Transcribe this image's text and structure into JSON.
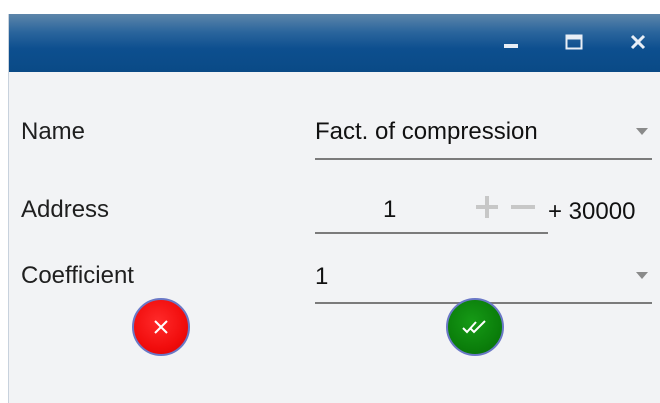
{
  "titlebar": {
    "minimize_icon": "minimize-icon",
    "maximize_icon": "maximize-icon",
    "close_icon": "close-icon",
    "color": "#0d4f8f"
  },
  "form": {
    "name": {
      "label": "Name",
      "value": "Fact. of compression"
    },
    "address": {
      "label": "Address",
      "value": "1",
      "suffix": "+ 30000",
      "increment_icon": "plus-icon",
      "decrement_icon": "minus-icon"
    },
    "coefficient": {
      "label": "Coefficient",
      "value": "1"
    }
  },
  "actions": {
    "cancel": {
      "icon": "close-icon",
      "color": "#f10d0d"
    },
    "ok": {
      "icon": "double-check-icon",
      "color": "#0b7f0b"
    }
  }
}
